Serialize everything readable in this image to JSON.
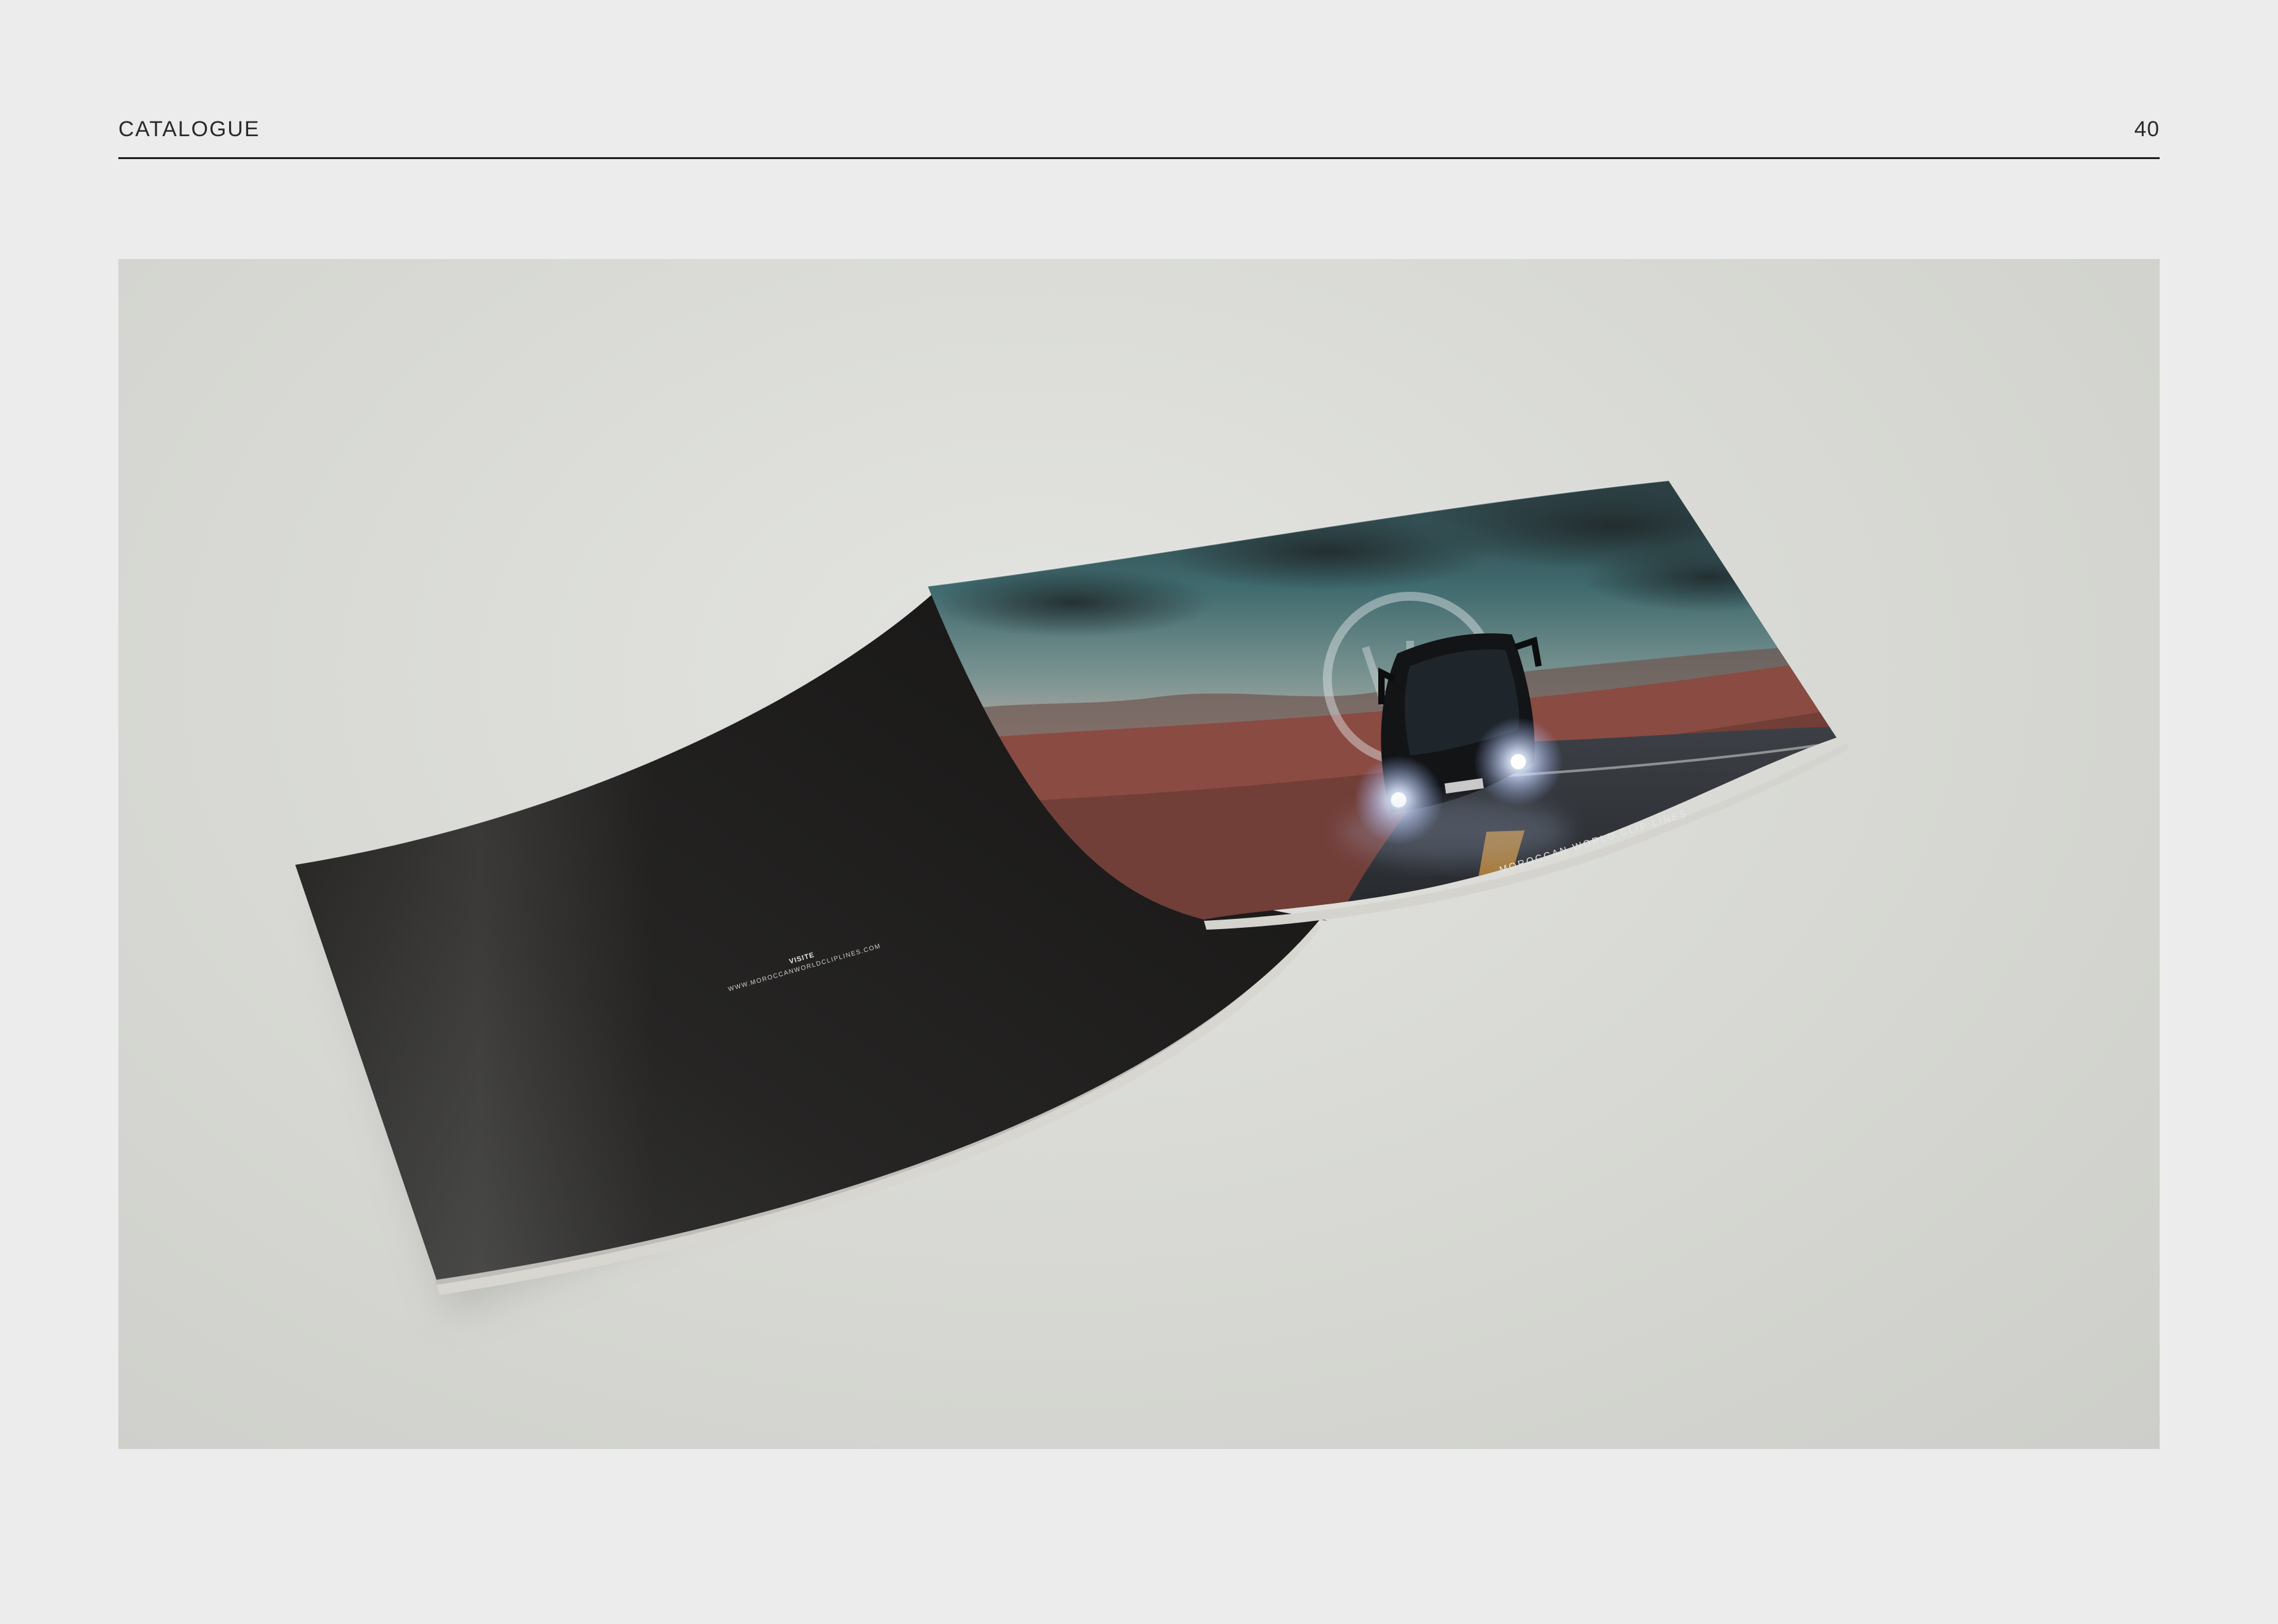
{
  "header": {
    "section_title": "CATALOGUE",
    "page_number": "40"
  },
  "mockup": {
    "back_cover": {
      "label": "VISITE",
      "url": "WWW.MOROCCANWORLDCLIPLINES.COM"
    },
    "front_cover": {
      "brand_line": "MOROCCAN WORLD CLIP LINES"
    }
  },
  "colors": {
    "page_background": "#ececec",
    "rule": "#1e1e1e",
    "cover_dark": "#1c1b1a"
  }
}
